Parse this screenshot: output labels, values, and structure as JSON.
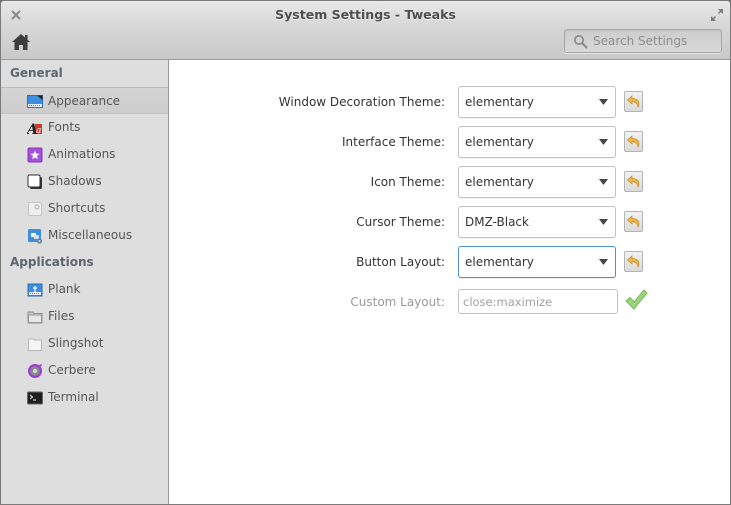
{
  "window": {
    "title": "System Settings - Tweaks"
  },
  "toolbar": {
    "search_placeholder": "Search Settings"
  },
  "sidebar": {
    "categories": [
      {
        "label": "General",
        "items": [
          {
            "label": "Appearance",
            "icon": "appearance-icon",
            "selected": true
          },
          {
            "label": "Fonts",
            "icon": "fonts-icon"
          },
          {
            "label": "Animations",
            "icon": "animations-icon"
          },
          {
            "label": "Shadows",
            "icon": "shadows-icon"
          },
          {
            "label": "Shortcuts",
            "icon": "shortcuts-icon"
          },
          {
            "label": "Miscellaneous",
            "icon": "miscellaneous-icon"
          }
        ]
      },
      {
        "label": "Applications",
        "items": [
          {
            "label": "Plank",
            "icon": "plank-icon"
          },
          {
            "label": "Files",
            "icon": "files-folder-icon"
          },
          {
            "label": "Slingshot",
            "icon": "slingshot-icon"
          },
          {
            "label": "Cerbere",
            "icon": "cerbere-icon"
          },
          {
            "label": "Terminal",
            "icon": "terminal-icon"
          }
        ]
      }
    ]
  },
  "settings": {
    "window_decoration_theme": {
      "label": "Window Decoration Theme:",
      "value": "elementary"
    },
    "interface_theme": {
      "label": "Interface Theme:",
      "value": "elementary"
    },
    "icon_theme": {
      "label": "Icon Theme:",
      "value": "elementary"
    },
    "cursor_theme": {
      "label": "Cursor Theme:",
      "value": "DMZ-Black"
    },
    "button_layout": {
      "label": "Button Layout:",
      "value": "elementary"
    },
    "custom_layout": {
      "label": "Custom Layout:",
      "placeholder": "close:maximize"
    }
  },
  "colors": {
    "focus_border": "#4d8fd0",
    "reset_arrow": "#f0b840",
    "apply_check": "#8ccf6e"
  }
}
